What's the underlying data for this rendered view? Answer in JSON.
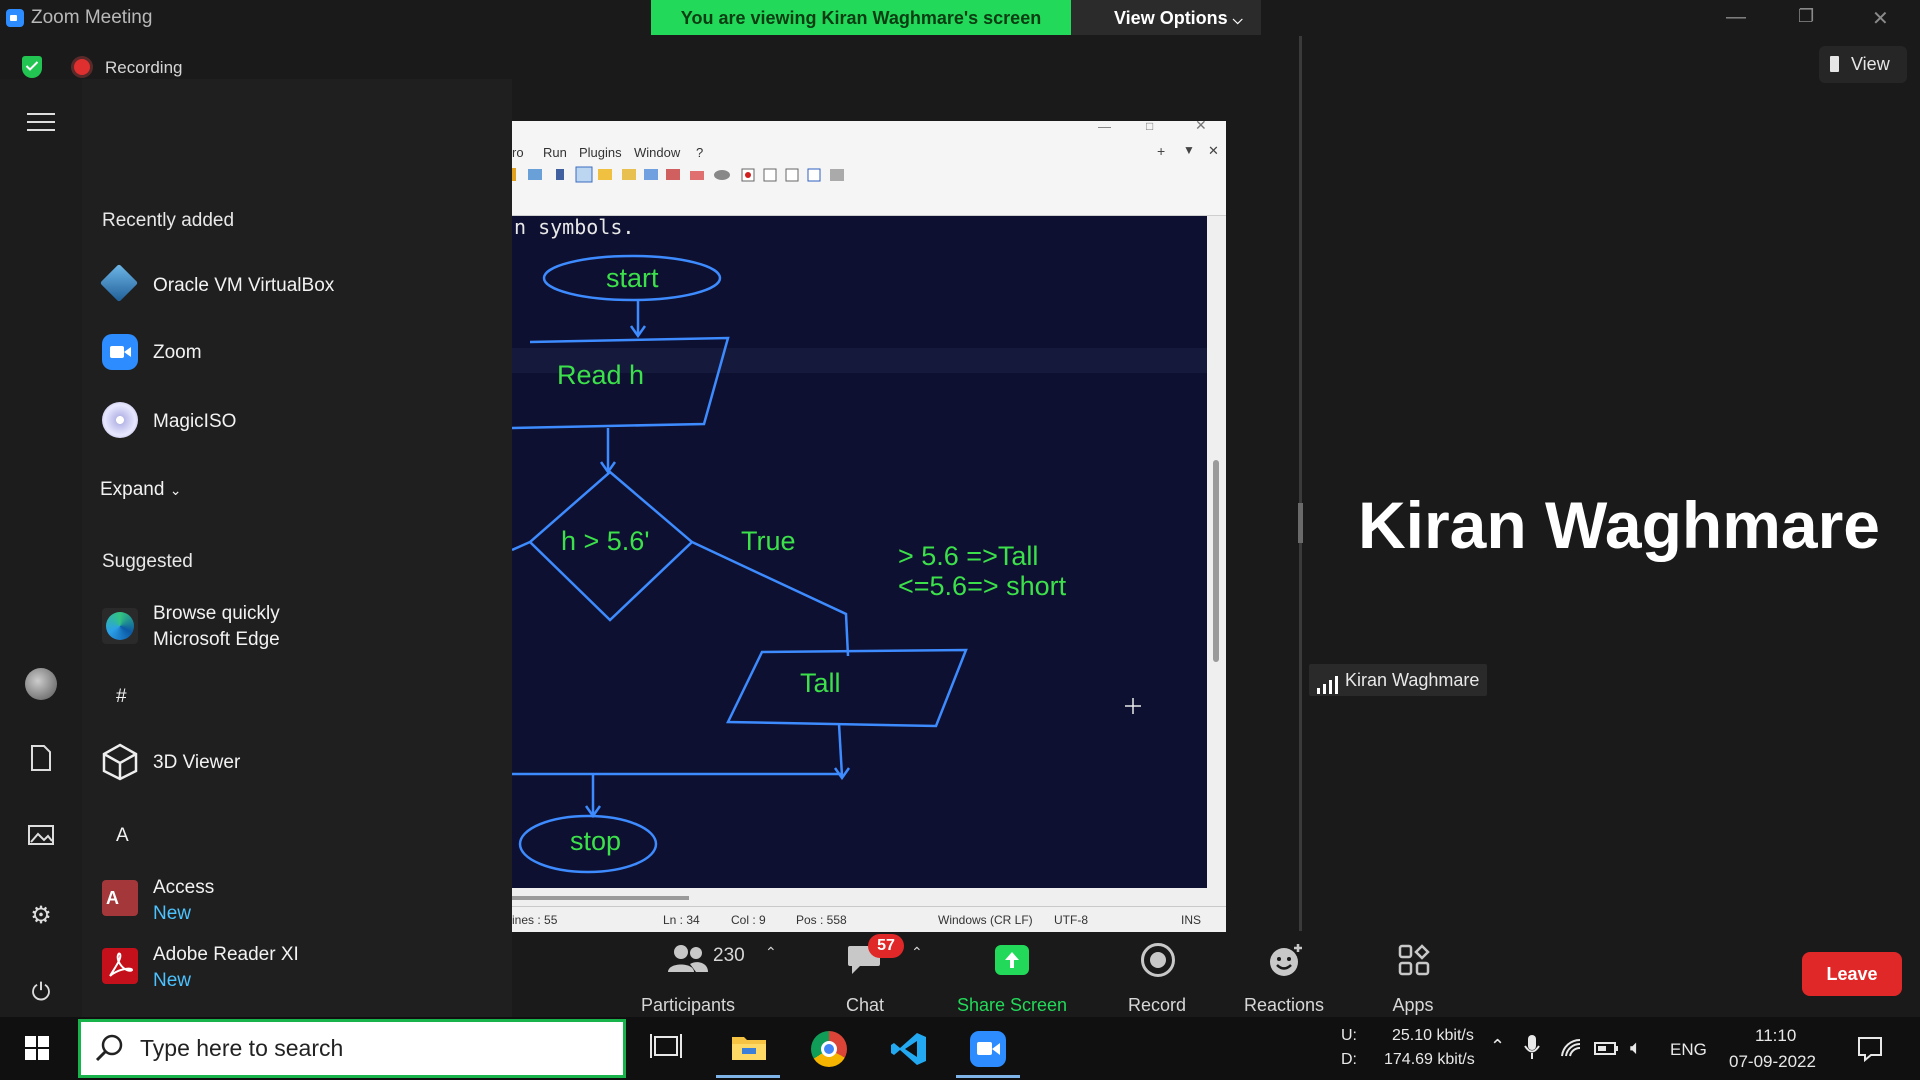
{
  "window": {
    "app_title": "Zoom Meeting",
    "viewing_banner": "You are viewing Kiran Waghmare's screen",
    "view_options": "View Options"
  },
  "recording": {
    "label": "Recording"
  },
  "start_menu": {
    "recently_added_label": "Recently added",
    "recent_apps": [
      {
        "label": "Oracle VM VirtualBox"
      },
      {
        "label": "Zoom"
      },
      {
        "label": "MagicISO"
      }
    ],
    "expand_label": "Expand",
    "suggested_label": "Suggested",
    "suggested": {
      "line1": "Browse quickly",
      "line2": "Microsoft Edge"
    },
    "hash_header": "#",
    "hash_app": "3D Viewer",
    "a_header": "A",
    "access": {
      "label": "Access",
      "badge": "New"
    },
    "adobe": {
      "label": "Adobe Reader XI",
      "badge": "New"
    }
  },
  "shared_screen": {
    "menu": [
      "ro",
      "Run",
      "Plugins",
      "Window",
      "?"
    ],
    "editor_text": "n symbols.",
    "flowchart": {
      "start": "start",
      "read": "Read h",
      "decision": "h > 5.6'",
      "true_label": "True",
      "tall": "Tall",
      "stop": "stop",
      "note_line1": "> 5.6 =>Tall",
      "note_line2": "<=5.6=> short"
    },
    "status": {
      "lines": "ines : 55",
      "ln": "Ln : 34",
      "col": "Col : 9",
      "pos": "Pos : 558",
      "eol": "Windows (CR LF)",
      "enc": "UTF-8",
      "mode": "INS"
    }
  },
  "participant": {
    "display_name": "Kiran Waghmare",
    "name_tag": "Kiran Waghmare",
    "view_button": "View"
  },
  "toolbar": {
    "participants_count": "230",
    "participants_label": "Participants",
    "chat_badge": "57",
    "chat_label": "Chat",
    "share_label": "Share Screen",
    "record_label": "Record",
    "reactions_label": "Reactions",
    "apps_label": "Apps",
    "leave_label": "Leave"
  },
  "taskbar": {
    "search_placeholder": "Type here to search",
    "net_u_label": "U:",
    "net_u": "25.10 kbit/s",
    "net_d_label": "D:",
    "net_d": "174.69 kbit/s",
    "lang": "ENG",
    "time": "11:10",
    "date": "07-09-2022"
  },
  "colors": {
    "banner": "#23d959",
    "share_green": "#23d959",
    "leave": "#e02828",
    "flow_line": "#3d8bff",
    "flow_text": "#3ce04a"
  }
}
